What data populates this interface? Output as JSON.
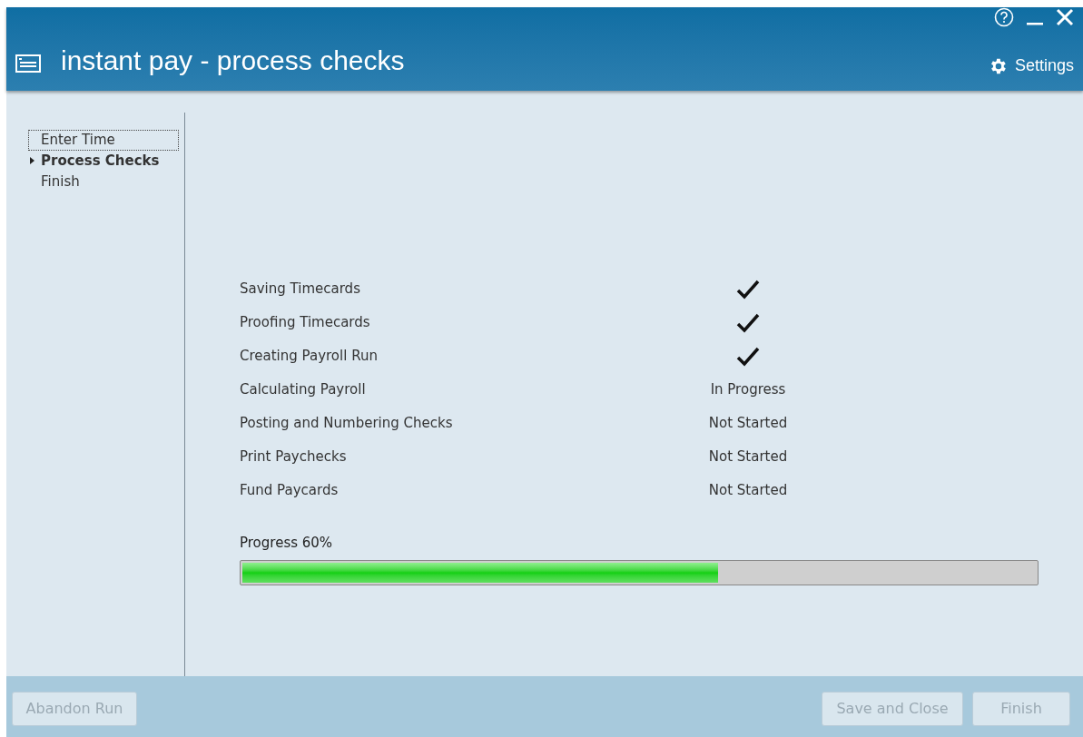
{
  "window": {
    "title": "instant pay - process checks",
    "settings_label": "Settings"
  },
  "sidebar": {
    "items": [
      {
        "label": "Enter Time",
        "selected": false,
        "focused": true
      },
      {
        "label": "Process Checks",
        "selected": true,
        "focused": false
      },
      {
        "label": "Finish",
        "selected": false,
        "focused": false
      }
    ]
  },
  "steps": [
    {
      "label": "Saving Timecards",
      "kind": "done"
    },
    {
      "label": "Proofing Timecards",
      "kind": "done"
    },
    {
      "label": "Creating Payroll Run",
      "kind": "done"
    },
    {
      "label": "Calculating Payroll",
      "kind": "text",
      "status": "In Progress"
    },
    {
      "label": "Posting and Numbering Checks",
      "kind": "text",
      "status": "Not Started"
    },
    {
      "label": "Print Paychecks",
      "kind": "text",
      "status": "Not Started"
    },
    {
      "label": "Fund Paycards",
      "kind": "text",
      "status": "Not Started"
    }
  ],
  "progress": {
    "label": "Progress 60%",
    "level": 0.6
  },
  "footer": {
    "left_buttons": [
      {
        "label": "Abandon Run",
        "disabled": true
      }
    ],
    "right_buttons": [
      {
        "label": "Save and Close",
        "disabled": true
      },
      {
        "label": "Finish",
        "disabled": true
      }
    ]
  }
}
